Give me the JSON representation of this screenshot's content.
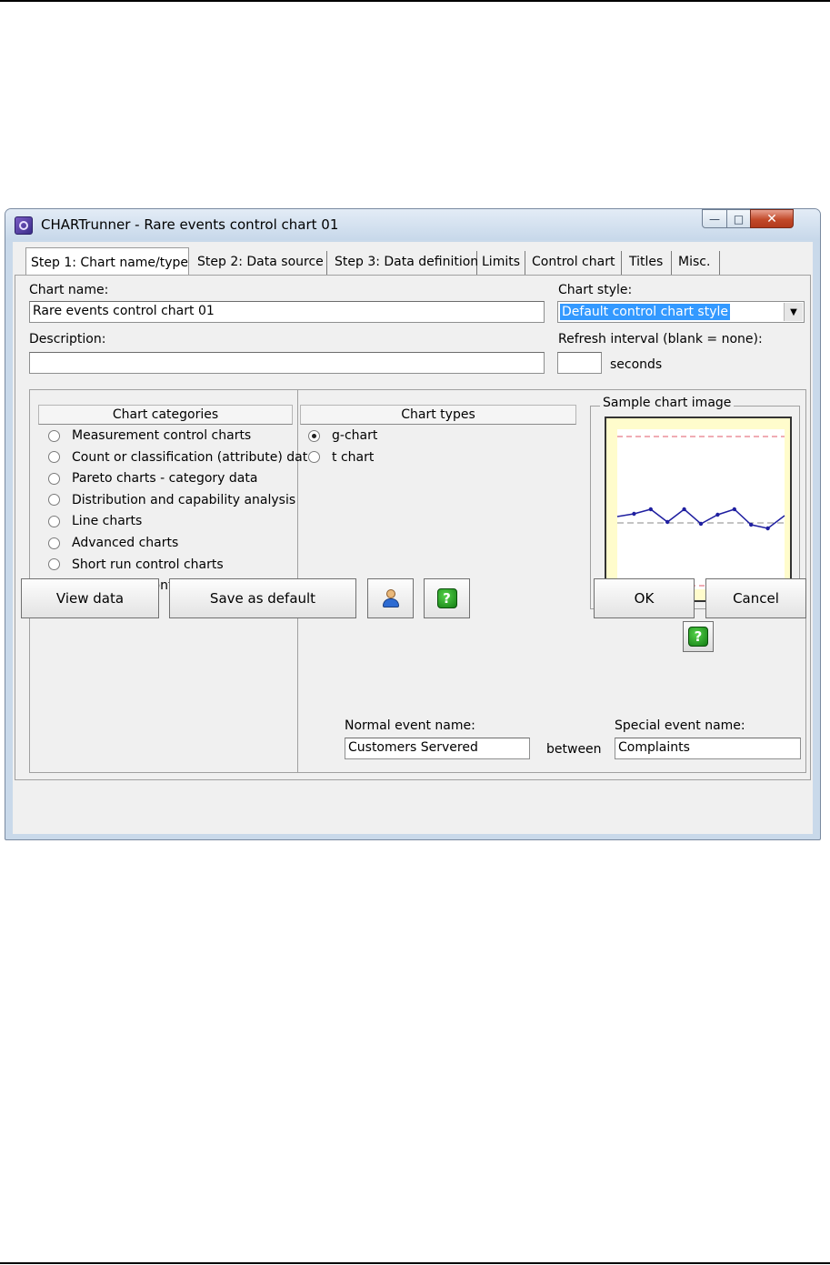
{
  "window": {
    "title": "CHARTrunner - Rare events control chart 01"
  },
  "tabs": [
    {
      "label": "Step 1: Chart name/type",
      "active": true
    },
    {
      "label": "Step 2: Data source"
    },
    {
      "label": "Step 3: Data definition"
    },
    {
      "label": "Limits"
    },
    {
      "label": "Control chart"
    },
    {
      "label": "Titles"
    },
    {
      "label": "Misc."
    }
  ],
  "form": {
    "chart_name_label": "Chart name:",
    "chart_name_value": "Rare events control chart 01",
    "chart_style_label": "Chart style:",
    "chart_style_value": "Default control chart style",
    "description_label": "Description:",
    "description_value": "",
    "refresh_label": "Refresh interval (blank = none):",
    "refresh_value": "",
    "refresh_unit": "seconds"
  },
  "categories": {
    "header": "Chart categories",
    "items": [
      {
        "label": "Measurement control charts",
        "checked": false
      },
      {
        "label": "Count or classification (attribute) dat",
        "checked": false
      },
      {
        "label": "Pareto charts - category data",
        "checked": false
      },
      {
        "label": "Distribution and capability analysis",
        "checked": false
      },
      {
        "label": "Line charts",
        "checked": false
      },
      {
        "label": "Advanced charts",
        "checked": false
      },
      {
        "label": "Short run control charts",
        "checked": false
      },
      {
        "label": "Rare event control charts",
        "checked": true
      }
    ]
  },
  "types": {
    "header": "Chart types",
    "items": [
      {
        "label": "g-chart",
        "checked": true
      },
      {
        "label": "t chart",
        "checked": false
      }
    ]
  },
  "sample": {
    "title": "Sample chart image",
    "points": [
      0.54,
      0.525,
      0.5,
      0.57,
      0.5,
      0.58,
      0.53,
      0.5,
      0.585,
      0.605,
      0.535
    ],
    "center": 0.575,
    "ucl": 0.1,
    "lcl": 0.92,
    "line_color": "#1f1fa0",
    "limit_color": "#e05a6a",
    "center_color": "#888888"
  },
  "events": {
    "normal_label": "Normal event name:",
    "normal_value": "Customers Servered",
    "between": "between",
    "special_label": "Special event name:",
    "special_value": "Complaints"
  },
  "buttons": {
    "view_data": "View data",
    "save_default": "Save as default",
    "ok": "OK",
    "cancel": "Cancel"
  },
  "icons": {
    "app": "chartrunner-app-icon",
    "user": "user-icon",
    "help": "help-icon",
    "help_glyph": "?"
  }
}
